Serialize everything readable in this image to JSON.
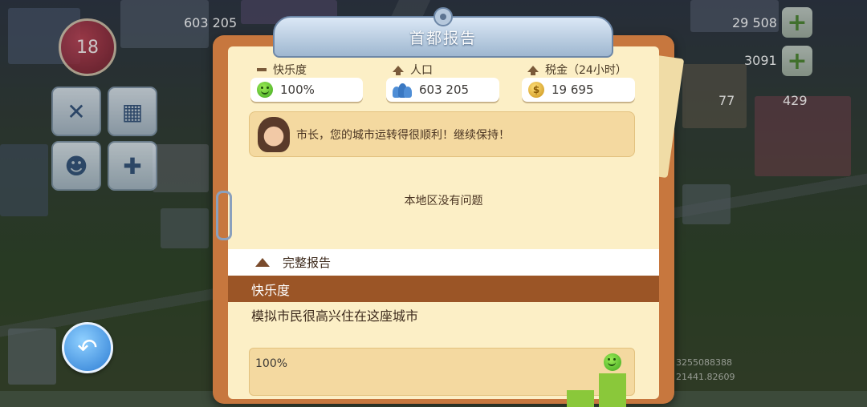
{
  "hud": {
    "level": "18",
    "population_top": "603 205",
    "cash": "29 508",
    "gold": "3091",
    "keys": "77",
    "tokens": "429",
    "bg_numbers": [
      "3255088388",
      "21441.82609"
    ]
  },
  "report": {
    "title": "首都报告",
    "stats": {
      "happiness_label": "快乐度",
      "happiness_value": "100%",
      "population_label": "人口",
      "population_value": "603 205",
      "tax_label": "税金（24小时）",
      "tax_value": "19 695"
    },
    "advisor_message": "市长，您的城市运转得很顺利！继续保持！",
    "no_issues": "本地区没有问题",
    "full_report_label": "完整报告",
    "section_title": "快乐度",
    "section_desc": "模拟市民很高兴住在这座城市",
    "graph_label": "100%"
  },
  "chart_data": {
    "type": "bar",
    "values": [
      50,
      100
    ],
    "ylabel": "",
    "ylim": [
      0,
      100
    ]
  },
  "colors": {
    "panel_frame": "#c7773e",
    "paper": "#fcefc6",
    "section_header": "#9b5526",
    "title_tab": "#9fb7d0",
    "bar": "#8ac83a"
  },
  "icons": [
    "level-badge-icon",
    "wrench-screwdriver-icon",
    "calendar-icon",
    "people-icon",
    "gamepad-icon",
    "plus-icon",
    "back-arrow-icon",
    "smile-icon",
    "coin-icon"
  ]
}
